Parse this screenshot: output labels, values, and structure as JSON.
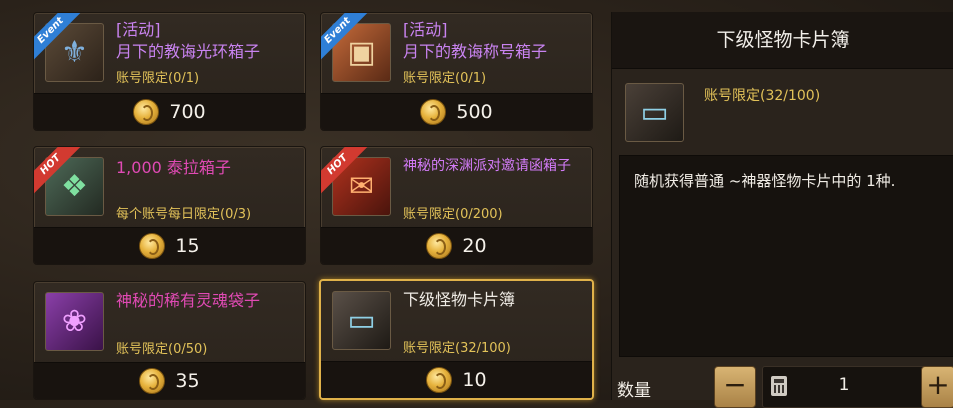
{
  "shop_items": [
    {
      "tag": "Event",
      "name": "[活动]\n月下的教诲光环箱子",
      "limit": "账号限定(0/1)",
      "price": "700"
    },
    {
      "tag": "Event",
      "name": "[活动]\n月下的教诲称号箱子",
      "limit": "账号限定(0/1)",
      "price": "500"
    },
    {
      "tag": "HOT",
      "name": "1,000 泰拉箱子",
      "limit": "每个账号每日限定(0/3)",
      "price": "15"
    },
    {
      "tag": "HOT",
      "name": "神秘的深渊派对邀请函箱子",
      "limit": "账号限定(0/200)",
      "price": "20"
    },
    {
      "tag": "",
      "name": "神秘的稀有灵魂袋子",
      "limit": "账号限定(0/50)",
      "price": "35"
    },
    {
      "tag": "",
      "name": "下级怪物卡片簿",
      "limit": "账号限定(32/100)",
      "price": "10"
    }
  ],
  "detail": {
    "title": "下级怪物卡片簿",
    "limit": "账号限定(32/100)",
    "description": "随机获得普通 ~神器怪物卡片中的 1种."
  },
  "quantity": {
    "label": "数量",
    "value": "1",
    "minus": "−",
    "plus": "+"
  },
  "icons": {
    "item_0": "event-armor-box-icon",
    "item_1": "event-title-chest-icon",
    "item_2": "tera-crate-icon",
    "item_3": "abyss-party-box-icon",
    "item_4": "soul-pouch-icon",
    "item_5": "card-album-icon",
    "calculator": "calculator-icon",
    "coin": "gold-coin-icon"
  },
  "colors": {
    "selected_border": "#e0b24a",
    "limit_text": "#e2c259",
    "event_ribbon": "#2f7fd6",
    "hot_ribbon": "#d23a30"
  }
}
